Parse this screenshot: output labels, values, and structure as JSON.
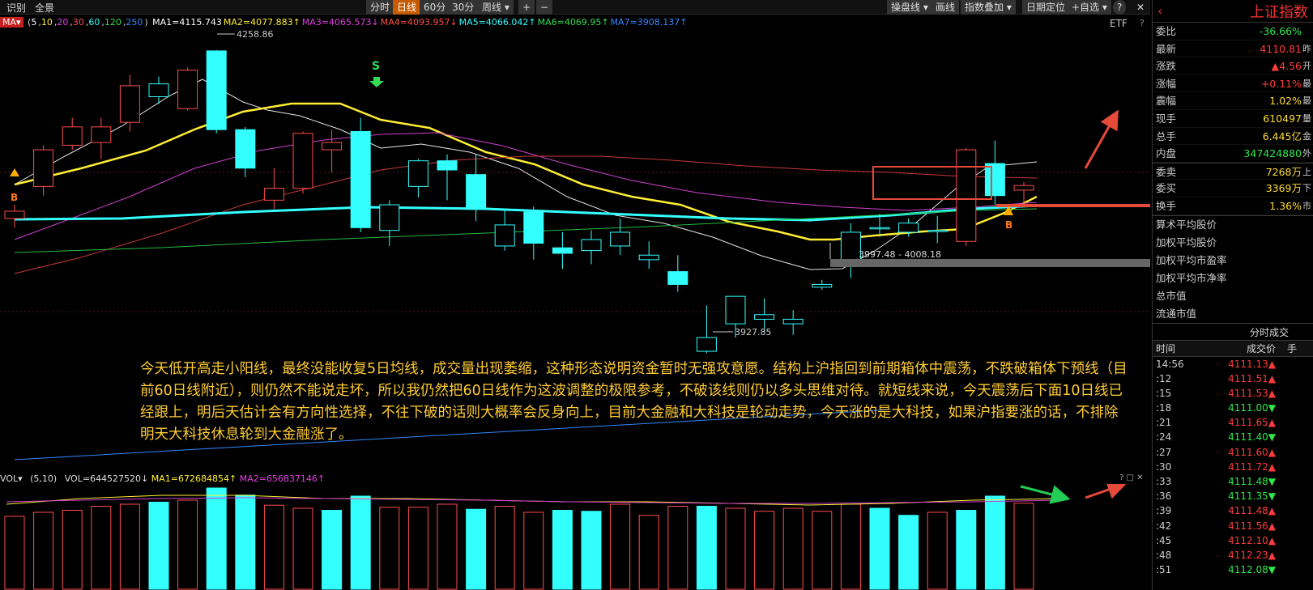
{
  "toolbar": {
    "left_items": [
      "识别",
      "全景"
    ],
    "tabs": [
      {
        "label": "分时",
        "active": false
      },
      {
        "label": "日线",
        "active": true
      },
      {
        "label": "60分",
        "active": false
      },
      {
        "label": "30分",
        "active": false
      },
      {
        "label": "周线 ▾",
        "active": false
      },
      {
        "label": "+",
        "active": false
      },
      {
        "label": "−",
        "active": false
      }
    ],
    "right_items": [
      "操盘线 ▾",
      "画线",
      "指数叠加 ▾",
      "日期定位",
      "+自选 ▾"
    ],
    "icons": [
      "help-icon",
      "close-icon"
    ]
  },
  "ma_line": {
    "badge": "MA▾",
    "params": "(5,10,20,30,60,120,250)",
    "items": [
      {
        "text": "MA1=4115.743",
        "color": "#ffffff"
      },
      {
        "text": "MA2=4077.883↑",
        "color": "#ffee33"
      },
      {
        "text": "MA3=4065.573↓",
        "color": "#e040e0"
      },
      {
        "text": "MA4=4093.957↓",
        "color": "#ff4d4d"
      },
      {
        "text": "MA5=4066.042↑",
        "color": "#33ffff"
      },
      {
        "text": "MA6=4069.95↑",
        "color": "#33dd55"
      },
      {
        "text": "MA7=3908.137↑",
        "color": "#3388ff"
      }
    ],
    "etf": "ETF",
    "help": "?"
  },
  "chart_labels": {
    "high_label": "4258.86",
    "low_label": "3927.85",
    "box_range": "3997.48 - 4008.18",
    "signal_s": "S",
    "signal_b": "B"
  },
  "annotation": "今天低开高走小阳线，最终没能收复5日均线，成交量出现萎缩，这种形态说明资金暂时无强攻意愿。结构上沪指回到前期箱体中震荡，不跌破箱体下预线（目前60日线附近），则仍然不能说走坏，所以我仍然把60日线作为这波调整的极限参考，不破该线则仍以多头思维对待。就短线来说，今天震荡后下面10日线已经跟上，明后天估计会有方向性选择，不往下破的话则大概率会反身向上，目前大金融和大科技是轮动走势，今天涨的是大科技，如果沪指要涨的话，不排除明天大科技休息轮到大金融涨了。",
  "volume": {
    "label": "VOL▾",
    "params": "(5,10)",
    "vol": "VOL=644527520↓",
    "ma1": "MA1=672684854↑",
    "ma2": "MA2=656837146↑",
    "ctrls": "? □ ✕"
  },
  "right_panel": {
    "title": "上证指数",
    "rows": [
      {
        "label": "委比",
        "value": "-36.66%",
        "cls": "green",
        "tail": ""
      },
      {
        "label": "最新",
        "value": "4110.81",
        "cls": "red",
        "tail": "昨"
      },
      {
        "label": "涨跌",
        "value": "▲4.56",
        "cls": "red",
        "tail": "开"
      },
      {
        "label": "涨幅",
        "value": "+0.11%",
        "cls": "red",
        "tail": "最"
      },
      {
        "label": "震幅",
        "value": "1.02%",
        "cls": "yellow",
        "tail": "最"
      },
      {
        "label": "现手",
        "value": "610497",
        "cls": "yellow",
        "tail": "量"
      },
      {
        "label": "总手",
        "value": "6.445亿",
        "cls": "yellow",
        "tail": "金"
      },
      {
        "label": "内盘",
        "value": "347424880",
        "cls": "green",
        "tail": "外"
      },
      {
        "label": "委卖",
        "value": "7268万",
        "cls": "yellow",
        "tail": "上"
      },
      {
        "label": "委买",
        "value": "3369万",
        "cls": "yellow",
        "tail": "下"
      },
      {
        "label": "换手",
        "value": "1.36%",
        "cls": "yellow",
        "tail": "市"
      }
    ],
    "links": [
      "算术平均股价",
      "加权平均股价",
      "加权平均市盈率",
      "加权平均市净率",
      "总市值",
      "流通市值"
    ],
    "fs_title": "分时成交",
    "tick_headers": {
      "time": "时间",
      "price": "成交价",
      "third": "手"
    },
    "ticks": [
      {
        "t": "14:56",
        "p": "4111.13▲",
        "cls": "red"
      },
      {
        "t": ":12",
        "p": "4111.51▲",
        "cls": "red"
      },
      {
        "t": ":15",
        "p": "4111.53▲",
        "cls": "red"
      },
      {
        "t": ":18",
        "p": "4111.00▼",
        "cls": "green"
      },
      {
        "t": ":21",
        "p": "4111.65▲",
        "cls": "red"
      },
      {
        "t": ":24",
        "p": "4111.40▼",
        "cls": "green"
      },
      {
        "t": ":27",
        "p": "4111.60▲",
        "cls": "red"
      },
      {
        "t": ":30",
        "p": "4111.72▲",
        "cls": "red"
      },
      {
        "t": ":33",
        "p": "4111.48▼",
        "cls": "green"
      },
      {
        "t": ":36",
        "p": "4111.35▼",
        "cls": "green"
      },
      {
        "t": ":39",
        "p": "4111.48▲",
        "cls": "red"
      },
      {
        "t": ":42",
        "p": "4111.56▲",
        "cls": "red"
      },
      {
        "t": ":45",
        "p": "4112.10▲",
        "cls": "red"
      },
      {
        "t": ":48",
        "p": "4112.23▲",
        "cls": "red"
      },
      {
        "t": ":51",
        "p": "4112.08▼",
        "cls": "green"
      }
    ]
  },
  "chart_data": {
    "type": "candlestick",
    "price_range": [
      3900,
      4280
    ],
    "candles": [
      {
        "o": 4075,
        "c": 4083,
        "h": 4090,
        "l": 4065,
        "up": true
      },
      {
        "o": 4110,
        "c": 4150,
        "h": 4155,
        "l": 4100,
        "up": true
      },
      {
        "o": 4155,
        "c": 4175,
        "h": 4185,
        "l": 4150,
        "up": true
      },
      {
        "o": 4158,
        "c": 4175,
        "h": 4185,
        "l": 4140,
        "up": true
      },
      {
        "o": 4180,
        "c": 4220,
        "h": 4232,
        "l": 4170,
        "up": true
      },
      {
        "o": 4208,
        "c": 4222,
        "h": 4230,
        "l": 4200,
        "up": false
      },
      {
        "o": 4195,
        "c": 4237,
        "h": 4240,
        "l": 4193,
        "up": true
      },
      {
        "o": 4258,
        "c": 4172,
        "h": 4258.86,
        "l": 4168,
        "up": false
      },
      {
        "o": 4172,
        "c": 4130,
        "h": 4175,
        "l": 4120,
        "up": false
      },
      {
        "o": 4095,
        "c": 4108,
        "h": 4130,
        "l": 4085,
        "up": true
      },
      {
        "o": 4108,
        "c": 4168,
        "h": 4170,
        "l": 4102,
        "up": true
      },
      {
        "o": 4150,
        "c": 4158,
        "h": 4172,
        "l": 4125,
        "up": true
      },
      {
        "o": 4170,
        "c": 4065,
        "h": 4185,
        "l": 4060,
        "up": false
      },
      {
        "o": 4062,
        "c": 4090,
        "h": 4095,
        "l": 4045,
        "up": false
      },
      {
        "o": 4110,
        "c": 4138,
        "h": 4140,
        "l": 4098,
        "up": false
      },
      {
        "o": 4138,
        "c": 4128,
        "h": 4145,
        "l": 4095,
        "up": false
      },
      {
        "o": 4123,
        "c": 4085,
        "h": 4145,
        "l": 4072,
        "up": false
      },
      {
        "o": 4045,
        "c": 4068,
        "h": 4085,
        "l": 4040,
        "up": false
      },
      {
        "o": 4082,
        "c": 4048,
        "h": 4088,
        "l": 4030,
        "up": false
      },
      {
        "o": 4043,
        "c": 4037,
        "h": 4060,
        "l": 4020,
        "up": false
      },
      {
        "o": 4040,
        "c": 4052,
        "h": 4062,
        "l": 4025,
        "up": false
      },
      {
        "o": 4045,
        "c": 4060,
        "h": 4075,
        "l": 4035,
        "up": false
      },
      {
        "o": 4030,
        "c": 4035,
        "h": 4050,
        "l": 4020,
        "up": false
      },
      {
        "o": 4017,
        "c": 4003,
        "h": 4035,
        "l": 3995,
        "up": false
      },
      {
        "o": 3930,
        "c": 3945,
        "h": 3980,
        "l": 3928,
        "up": false
      },
      {
        "o": 3960,
        "c": 3990,
        "h": 3990,
        "l": 3945,
        "up": false
      },
      {
        "o": 3965,
        "c": 3970,
        "h": 3988,
        "l": 3950,
        "up": false
      },
      {
        "o": 3960,
        "c": 3965,
        "h": 3975,
        "l": 3948,
        "up": false
      },
      {
        "o": 4000,
        "c": 4003,
        "h": 4008,
        "l": 3997,
        "up": false
      },
      {
        "o": 4028,
        "c": 4060,
        "h": 4070,
        "l": 4010,
        "up": false
      },
      {
        "o": 4065,
        "c": 4065,
        "h": 4080,
        "l": 4055,
        "up": false
      },
      {
        "o": 4060,
        "c": 4070,
        "h": 4075,
        "l": 4055,
        "up": false
      },
      {
        "o": 4062,
        "c": 4062,
        "h": 4078,
        "l": 4048,
        "up": false
      },
      {
        "o": 4050,
        "c": 4150,
        "h": 4152,
        "l": 4045,
        "up": true
      },
      {
        "o": 4135,
        "c": 4100,
        "h": 4160,
        "l": 4090,
        "up": false
      },
      {
        "o": 4106,
        "c": 4111,
        "h": 4115,
        "l": 4090,
        "up": true
      }
    ],
    "volumes": [
      0.72,
      0.76,
      0.78,
      0.82,
      0.84,
      0.86,
      0.88,
      1.0,
      0.93,
      0.83,
      0.8,
      0.78,
      0.92,
      0.81,
      0.81,
      0.84,
      0.79,
      0.82,
      0.76,
      0.78,
      0.77,
      0.84,
      0.73,
      0.82,
      0.82,
      0.8,
      0.77,
      0.8,
      0.77,
      0.84,
      0.8,
      0.73,
      0.76,
      0.78,
      0.92,
      0.85
    ],
    "volume_colors": [
      "red",
      "red",
      "red",
      "red",
      "red",
      "cyan",
      "red",
      "cyan",
      "cyan",
      "red",
      "red",
      "cyan",
      "cyan",
      "red",
      "red",
      "red",
      "cyan",
      "red",
      "red",
      "cyan",
      "cyan",
      "red",
      "red",
      "red",
      "cyan",
      "red",
      "red",
      "red",
      "red",
      "red",
      "cyan",
      "cyan",
      "red",
      "cyan",
      "cyan",
      "red"
    ]
  }
}
